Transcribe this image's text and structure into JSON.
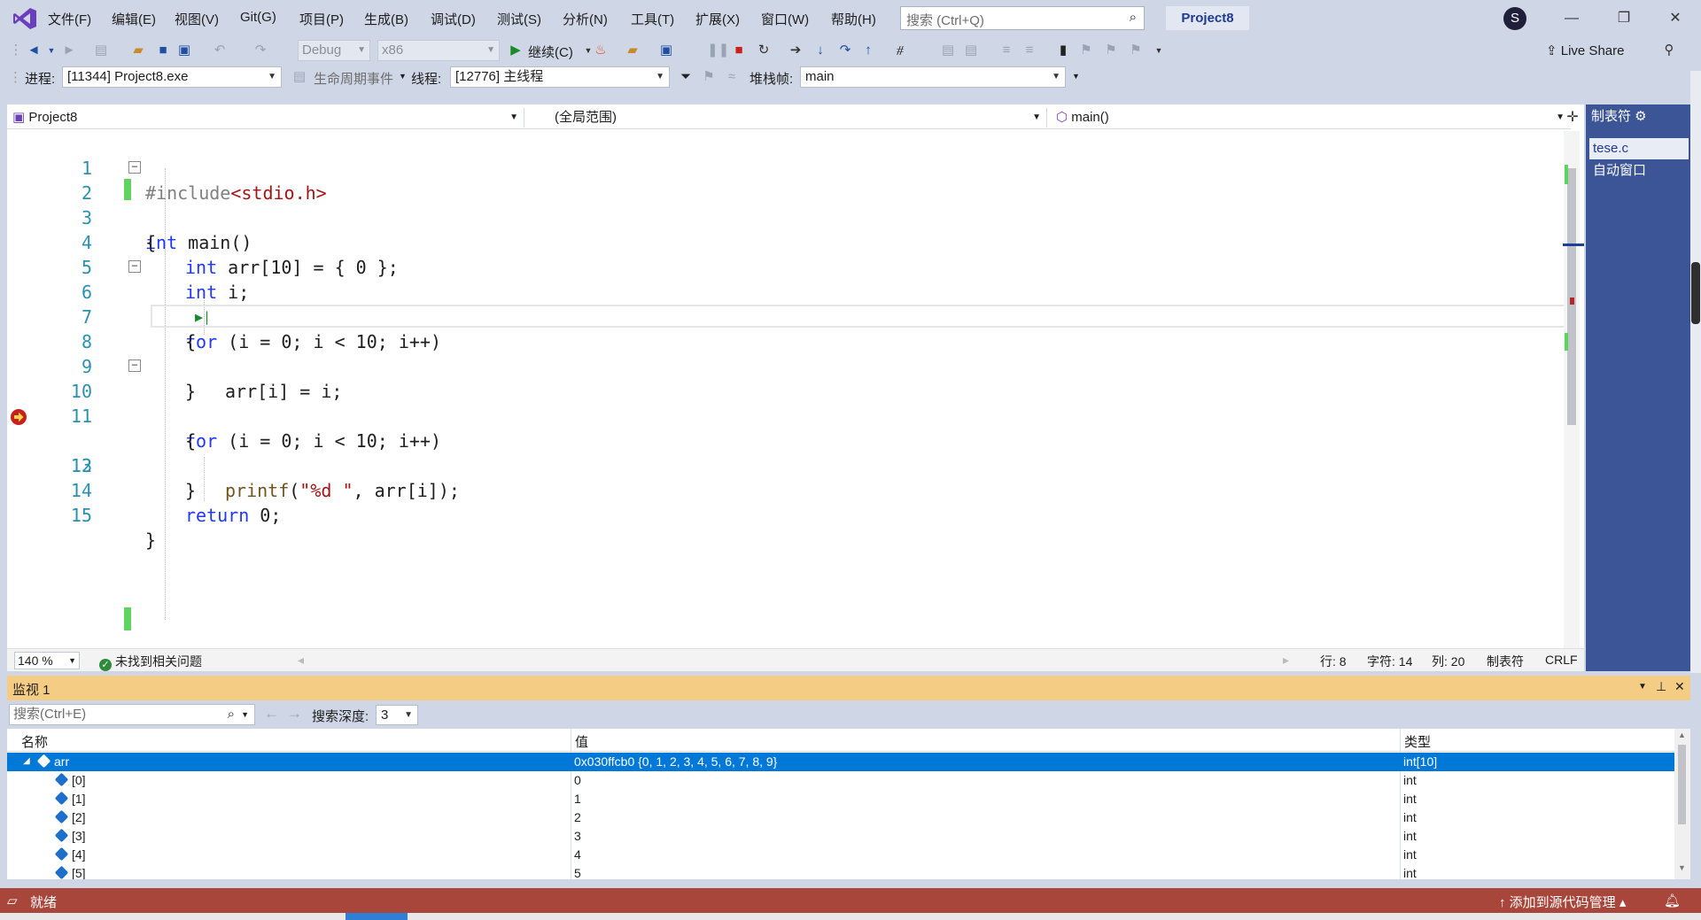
{
  "menu": {
    "items": [
      "文件(F)",
      "编辑(E)",
      "视图(V)",
      "Git(G)",
      "项目(P)",
      "生成(B)",
      "调试(D)",
      "测试(S)",
      "分析(N)",
      "工具(T)",
      "扩展(X)",
      "窗口(W)",
      "帮助(H)"
    ],
    "search_placeholder": "搜索 (Ctrl+Q)",
    "project_title": "Project8",
    "avatar_letter": "S"
  },
  "toolbar1": {
    "config": "Debug",
    "platform": "x86",
    "continue_label": "继续(C)",
    "live_share": "Live Share"
  },
  "toolbar2": {
    "process_label": "进程:",
    "process_value": "[11344] Project8.exe",
    "lifecycle_label": "生命周期事件",
    "thread_label": "线程:",
    "thread_value": "[12776] 主线程",
    "stack_label": "堆栈帧:",
    "stack_value": "main"
  },
  "editor": {
    "nav_project": "Project8",
    "nav_scope": "(全局范围)",
    "nav_function": "main()",
    "lines": [
      {
        "n": "1"
      },
      {
        "n": "2"
      },
      {
        "n": "3"
      },
      {
        "n": "4"
      },
      {
        "n": "5"
      },
      {
        "n": "6"
      },
      {
        "n": "7"
      },
      {
        "n": "8"
      },
      {
        "n": "9"
      },
      {
        "n": "10"
      },
      {
        "n": "11"
      },
      {
        "n": "12"
      },
      {
        "n": "13"
      },
      {
        "n": "14"
      },
      {
        "n": "15"
      }
    ],
    "code": {
      "l1_pp": "#include",
      "l1_inc": "<stdio.h>",
      "l2_kw": "int",
      "l2_rest": " main()",
      "l3": "{",
      "l4_kw": "int",
      "l4_rest": " arr[10] = { 0 };",
      "l5_kw": "int",
      "l5_rest": " i;",
      "l6_kw": "for",
      "l6_rest": " (i = 0; i < 10; i++)",
      "l7": "{",
      "l8": "arr[i] = i;",
      "l9": "}",
      "l10_kw": "for",
      "l10_rest": " (i = 0; i < 10; i++)",
      "l11": "{",
      "l12_fn": "printf",
      "l12_a": "(",
      "l12_str": "\"%d \"",
      "l12_b": ", arr[i]);",
      "l13": "}",
      "l14_kw": "return",
      "l14_rest": " 0;",
      "l15": "}"
    },
    "zoom": "140 %",
    "issues": "未找到相关问题",
    "row": "行: 8",
    "char": "字符: 14",
    "col": "列: 20",
    "tabs": "制表符",
    "eol": "CRLF"
  },
  "right_panel": {
    "header": "制表符",
    "tab1": "tese.c",
    "tab2": "自动窗口"
  },
  "watch": {
    "title": "监视 1",
    "search_placeholder": "搜索(Ctrl+E)",
    "depth_label": "搜索深度:",
    "depth_value": "3",
    "col_name": "名称",
    "col_value": "值",
    "col_type": "类型",
    "rows": [
      {
        "name": "arr",
        "value": "0x030ffcb0 {0, 1, 2, 3, 4, 5, 6, 7, 8, 9}",
        "type": "int[10]"
      },
      {
        "name": "[0]",
        "value": "0",
        "type": "int"
      },
      {
        "name": "[1]",
        "value": "1",
        "type": "int"
      },
      {
        "name": "[2]",
        "value": "2",
        "type": "int"
      },
      {
        "name": "[3]",
        "value": "3",
        "type": "int"
      },
      {
        "name": "[4]",
        "value": "4",
        "type": "int"
      },
      {
        "name": "[5]",
        "value": "5",
        "type": "int"
      }
    ]
  },
  "status": {
    "ready": "就绪",
    "source_control": "添加到源代码管理"
  },
  "colors": {
    "status_bar": "#a9463b",
    "watch_header": "#f5cc84",
    "selection": "#0078d7",
    "keyword": "#1f37ff",
    "line_number": "#2b91af"
  }
}
